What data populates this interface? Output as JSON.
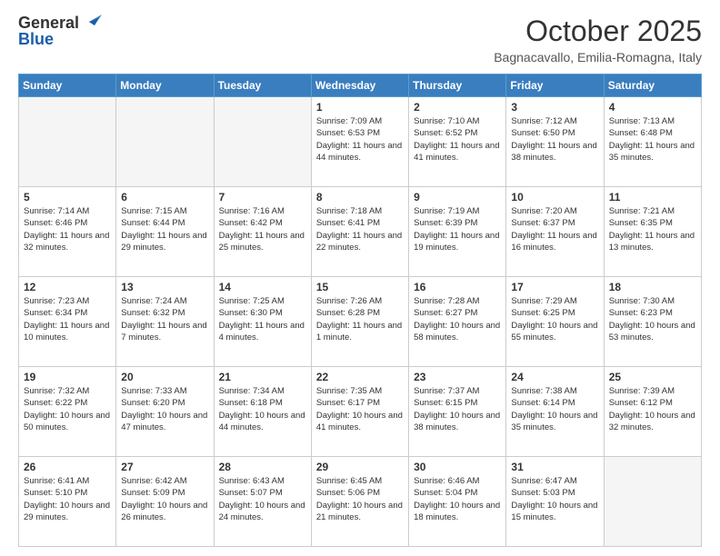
{
  "header": {
    "logo_general": "General",
    "logo_blue": "Blue",
    "month_title": "October 2025",
    "location": "Bagnacavallo, Emilia-Romagna, Italy"
  },
  "days_of_week": [
    "Sunday",
    "Monday",
    "Tuesday",
    "Wednesday",
    "Thursday",
    "Friday",
    "Saturday"
  ],
  "weeks": [
    [
      {
        "day": "",
        "info": ""
      },
      {
        "day": "",
        "info": ""
      },
      {
        "day": "",
        "info": ""
      },
      {
        "day": "1",
        "info": "Sunrise: 7:09 AM\nSunset: 6:53 PM\nDaylight: 11 hours and 44 minutes."
      },
      {
        "day": "2",
        "info": "Sunrise: 7:10 AM\nSunset: 6:52 PM\nDaylight: 11 hours and 41 minutes."
      },
      {
        "day": "3",
        "info": "Sunrise: 7:12 AM\nSunset: 6:50 PM\nDaylight: 11 hours and 38 minutes."
      },
      {
        "day": "4",
        "info": "Sunrise: 7:13 AM\nSunset: 6:48 PM\nDaylight: 11 hours and 35 minutes."
      }
    ],
    [
      {
        "day": "5",
        "info": "Sunrise: 7:14 AM\nSunset: 6:46 PM\nDaylight: 11 hours and 32 minutes."
      },
      {
        "day": "6",
        "info": "Sunrise: 7:15 AM\nSunset: 6:44 PM\nDaylight: 11 hours and 29 minutes."
      },
      {
        "day": "7",
        "info": "Sunrise: 7:16 AM\nSunset: 6:42 PM\nDaylight: 11 hours and 25 minutes."
      },
      {
        "day": "8",
        "info": "Sunrise: 7:18 AM\nSunset: 6:41 PM\nDaylight: 11 hours and 22 minutes."
      },
      {
        "day": "9",
        "info": "Sunrise: 7:19 AM\nSunset: 6:39 PM\nDaylight: 11 hours and 19 minutes."
      },
      {
        "day": "10",
        "info": "Sunrise: 7:20 AM\nSunset: 6:37 PM\nDaylight: 11 hours and 16 minutes."
      },
      {
        "day": "11",
        "info": "Sunrise: 7:21 AM\nSunset: 6:35 PM\nDaylight: 11 hours and 13 minutes."
      }
    ],
    [
      {
        "day": "12",
        "info": "Sunrise: 7:23 AM\nSunset: 6:34 PM\nDaylight: 11 hours and 10 minutes."
      },
      {
        "day": "13",
        "info": "Sunrise: 7:24 AM\nSunset: 6:32 PM\nDaylight: 11 hours and 7 minutes."
      },
      {
        "day": "14",
        "info": "Sunrise: 7:25 AM\nSunset: 6:30 PM\nDaylight: 11 hours and 4 minutes."
      },
      {
        "day": "15",
        "info": "Sunrise: 7:26 AM\nSunset: 6:28 PM\nDaylight: 11 hours and 1 minute."
      },
      {
        "day": "16",
        "info": "Sunrise: 7:28 AM\nSunset: 6:27 PM\nDaylight: 10 hours and 58 minutes."
      },
      {
        "day": "17",
        "info": "Sunrise: 7:29 AM\nSunset: 6:25 PM\nDaylight: 10 hours and 55 minutes."
      },
      {
        "day": "18",
        "info": "Sunrise: 7:30 AM\nSunset: 6:23 PM\nDaylight: 10 hours and 53 minutes."
      }
    ],
    [
      {
        "day": "19",
        "info": "Sunrise: 7:32 AM\nSunset: 6:22 PM\nDaylight: 10 hours and 50 minutes."
      },
      {
        "day": "20",
        "info": "Sunrise: 7:33 AM\nSunset: 6:20 PM\nDaylight: 10 hours and 47 minutes."
      },
      {
        "day": "21",
        "info": "Sunrise: 7:34 AM\nSunset: 6:18 PM\nDaylight: 10 hours and 44 minutes."
      },
      {
        "day": "22",
        "info": "Sunrise: 7:35 AM\nSunset: 6:17 PM\nDaylight: 10 hours and 41 minutes."
      },
      {
        "day": "23",
        "info": "Sunrise: 7:37 AM\nSunset: 6:15 PM\nDaylight: 10 hours and 38 minutes."
      },
      {
        "day": "24",
        "info": "Sunrise: 7:38 AM\nSunset: 6:14 PM\nDaylight: 10 hours and 35 minutes."
      },
      {
        "day": "25",
        "info": "Sunrise: 7:39 AM\nSunset: 6:12 PM\nDaylight: 10 hours and 32 minutes."
      }
    ],
    [
      {
        "day": "26",
        "info": "Sunrise: 6:41 AM\nSunset: 5:10 PM\nDaylight: 10 hours and 29 minutes."
      },
      {
        "day": "27",
        "info": "Sunrise: 6:42 AM\nSunset: 5:09 PM\nDaylight: 10 hours and 26 minutes."
      },
      {
        "day": "28",
        "info": "Sunrise: 6:43 AM\nSunset: 5:07 PM\nDaylight: 10 hours and 24 minutes."
      },
      {
        "day": "29",
        "info": "Sunrise: 6:45 AM\nSunset: 5:06 PM\nDaylight: 10 hours and 21 minutes."
      },
      {
        "day": "30",
        "info": "Sunrise: 6:46 AM\nSunset: 5:04 PM\nDaylight: 10 hours and 18 minutes."
      },
      {
        "day": "31",
        "info": "Sunrise: 6:47 AM\nSunset: 5:03 PM\nDaylight: 10 hours and 15 minutes."
      },
      {
        "day": "",
        "info": ""
      }
    ]
  ]
}
